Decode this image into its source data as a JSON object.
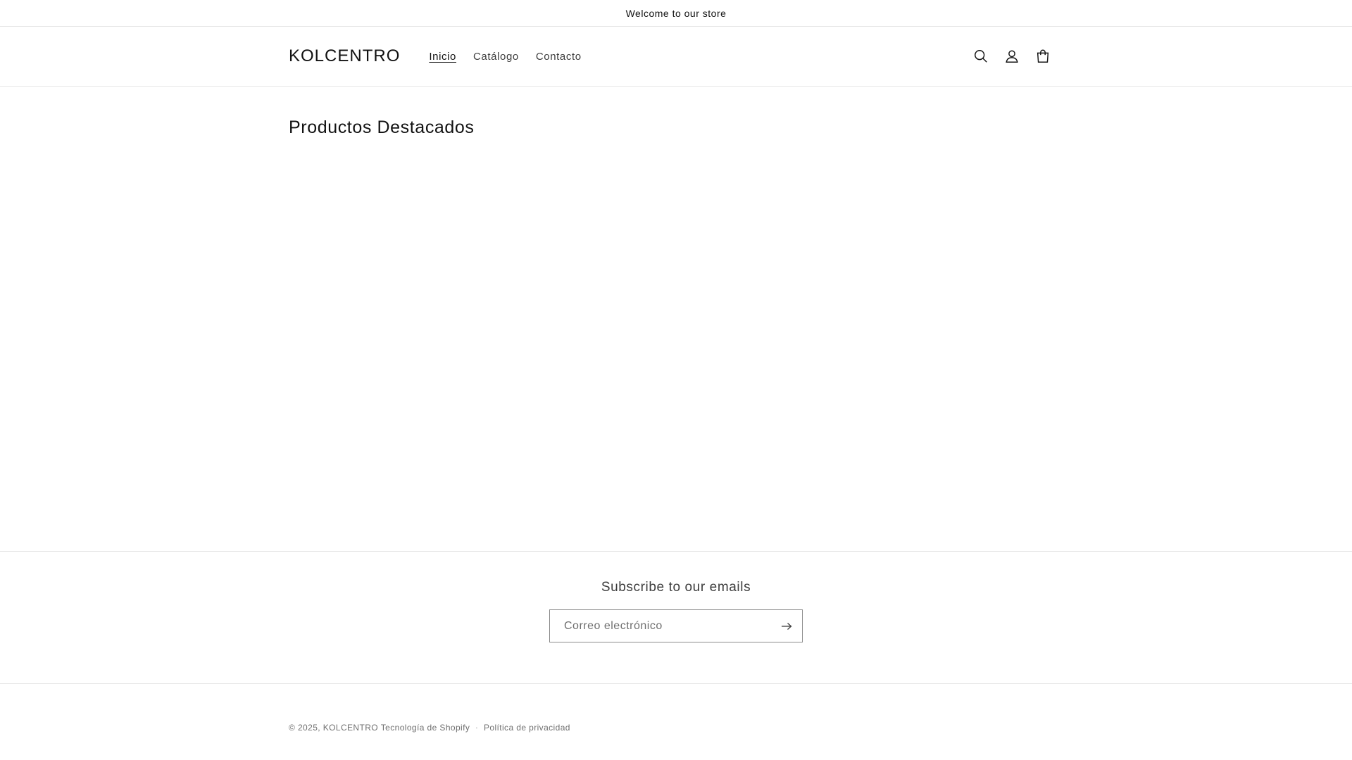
{
  "announcement": {
    "text": "Welcome to our store"
  },
  "header": {
    "logo": "KOLCENTRO",
    "nav": [
      {
        "label": "Inicio",
        "active": true
      },
      {
        "label": "Catálogo",
        "active": false
      },
      {
        "label": "Contacto",
        "active": false
      }
    ],
    "icons": [
      "search-icon",
      "account-icon",
      "cart-icon"
    ]
  },
  "main": {
    "title": "Productos Destacados"
  },
  "newsletter": {
    "title": "Subscribe to our emails",
    "placeholder": "Correo electrónico"
  },
  "footer": {
    "copyright_prefix": "© 2025,",
    "brand_link": "KOLCENTRO",
    "powered_by": "Tecnología de Shopify",
    "separator": "·",
    "policy_link": "Política de privacidad"
  }
}
